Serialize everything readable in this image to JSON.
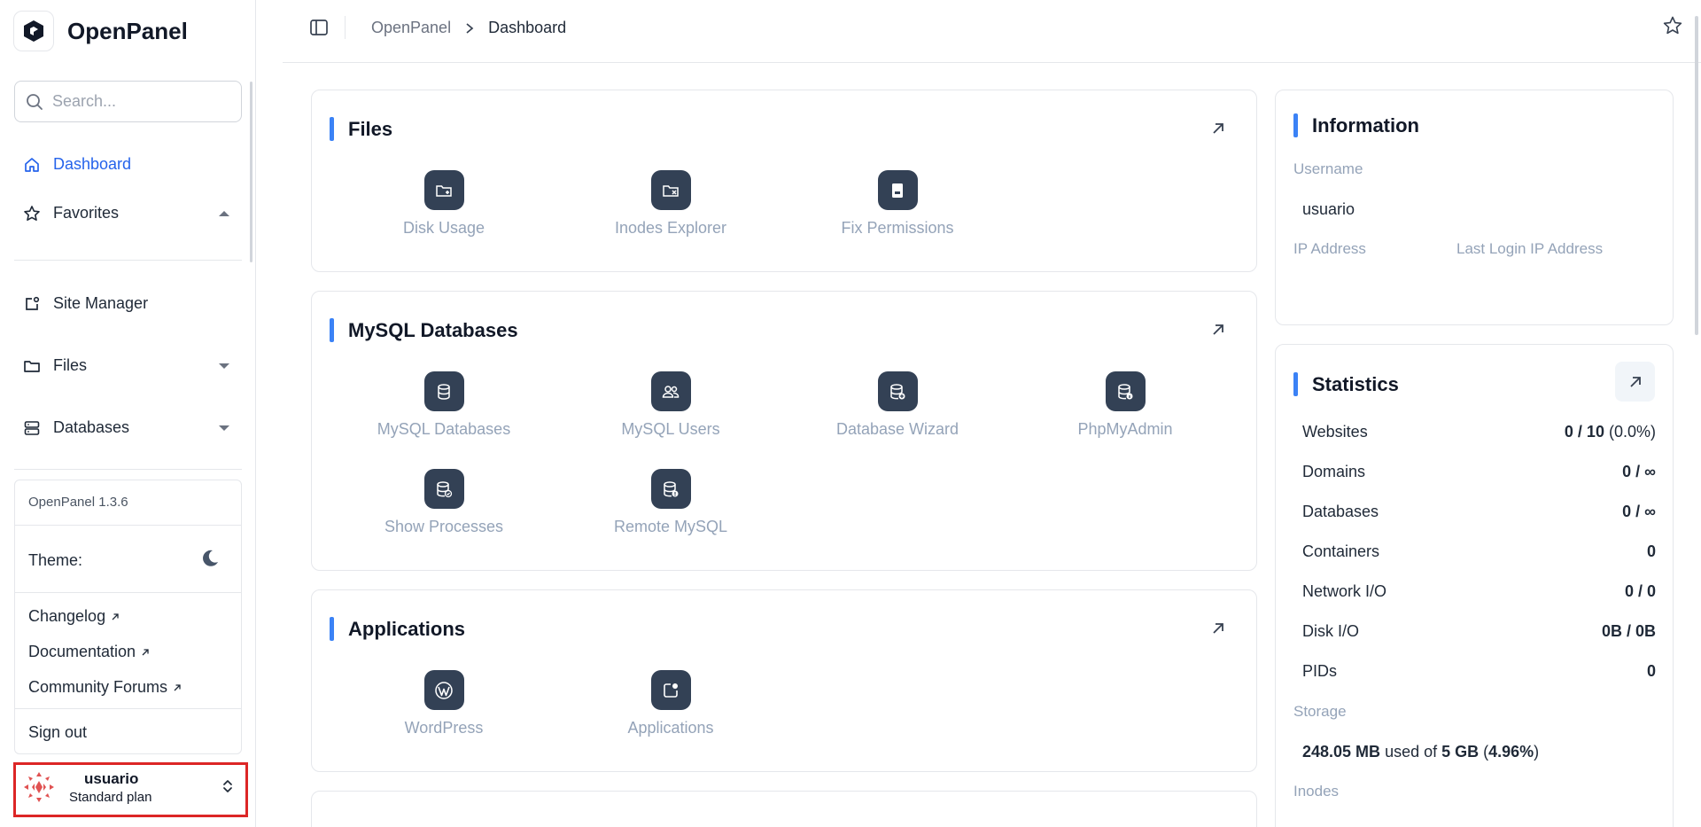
{
  "app": {
    "name": "OpenPanel"
  },
  "sidebar": {
    "search_placeholder": "Search...",
    "nav": [
      {
        "label": "Dashboard",
        "icon": "home-icon",
        "active": true
      },
      {
        "label": "Favorites",
        "icon": "star-icon"
      },
      {
        "label": "Site Manager",
        "icon": "site-manager-icon"
      },
      {
        "label": "Files",
        "icon": "folder-icon"
      },
      {
        "label": "Databases",
        "icon": "database-icon"
      }
    ],
    "panel": {
      "version": "OpenPanel 1.3.6",
      "theme_label": "Theme:",
      "links": [
        "Changelog",
        "Documentation",
        "Community Forums"
      ],
      "sign_out": "Sign out"
    },
    "user": {
      "name": "usuario",
      "plan": "Standard plan"
    }
  },
  "header": {
    "breadcrumb": [
      "OpenPanel",
      "Dashboard"
    ]
  },
  "cards": {
    "files": {
      "title": "Files",
      "items": [
        "Disk Usage",
        "Inodes Explorer",
        "Fix Permissions"
      ]
    },
    "mysql": {
      "title": "MySQL Databases",
      "items": [
        "MySQL Databases",
        "MySQL Users",
        "Database Wizard",
        "PhpMyAdmin",
        "Show Processes",
        "Remote MySQL"
      ]
    },
    "applications": {
      "title": "Applications",
      "items": [
        "WordPress",
        "Applications"
      ]
    }
  },
  "information": {
    "title": "Information",
    "username_label": "Username",
    "username": "usuario",
    "ip_label": "IP Address",
    "last_login_label": "Last Login IP Address"
  },
  "statistics": {
    "title": "Statistics",
    "rows": [
      {
        "label": "Websites",
        "value_bold": "0 / 10",
        "value_rest": " (0.0%)"
      },
      {
        "label": "Domains",
        "value_bold": "0 / ∞",
        "value_rest": ""
      },
      {
        "label": "Databases",
        "value_bold": "0 / ∞",
        "value_rest": ""
      },
      {
        "label": "Containers",
        "value_bold": "0",
        "value_rest": ""
      },
      {
        "label": "Network I/O",
        "value_bold": "0 / 0",
        "value_rest": ""
      },
      {
        "label": "Disk I/O",
        "value_bold": "0B / 0B",
        "value_rest": ""
      },
      {
        "label": "PIDs",
        "value_bold": "0",
        "value_rest": ""
      }
    ],
    "storage_label": "Storage",
    "storage": {
      "used": "248.05 MB",
      "mid": " used of ",
      "total": "5 GB",
      "pct_open": " (",
      "pct": "4.96%",
      "pct_close": ")"
    },
    "inodes_label": "Inodes"
  }
}
